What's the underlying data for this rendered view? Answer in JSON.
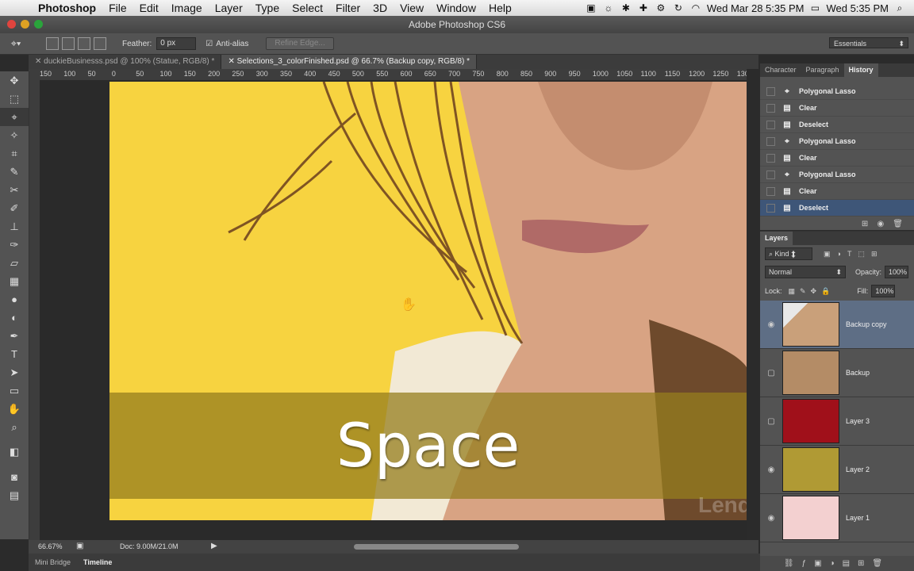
{
  "menubar": {
    "app": "Photoshop",
    "items": [
      "File",
      "Edit",
      "Image",
      "Layer",
      "Type",
      "Select",
      "Filter",
      "3D",
      "View",
      "Window",
      "Help"
    ],
    "date1": "Wed Mar 28  5:35 PM",
    "date2": "Wed 5:35 PM"
  },
  "window": {
    "title": "Adobe Photoshop CS6"
  },
  "options": {
    "feather_label": "Feather:",
    "feather_value": "0 px",
    "antialias_label": "Anti-alias",
    "refine_label": "Refine Edge...",
    "workspace": "Essentials"
  },
  "tabs": [
    {
      "label": "duckieBusinesss.psd @ 100% (Statue, RGB/8) *"
    },
    {
      "label": "Selections_3_colorFinished.psd @ 66.7% (Backup copy, RGB/8) *"
    }
  ],
  "ruler_ticks": [
    "150",
    "100",
    "50",
    "0",
    "50",
    "100",
    "150",
    "200",
    "250",
    "300",
    "350",
    "400",
    "450",
    "500",
    "550",
    "600",
    "650",
    "700",
    "750",
    "800",
    "850",
    "900",
    "950",
    "1000",
    "1050",
    "1100",
    "1150",
    "1200",
    "1250",
    "1300"
  ],
  "canvas": {
    "overlay_text": "Space",
    "watermark": "Lendwings"
  },
  "status": {
    "zoom": "66.67%",
    "doc": "Doc: 9.00M/21.0M"
  },
  "bottom_tabs": [
    "Mini Bridge",
    "Timeline"
  ],
  "history": {
    "tabs": [
      "Character",
      "Paragraph",
      "History"
    ],
    "items": [
      {
        "label": "Polygonal Lasso",
        "icon": "lasso-icon"
      },
      {
        "label": "Clear",
        "icon": "doc-icon"
      },
      {
        "label": "Deselect",
        "icon": "doc-icon"
      },
      {
        "label": "Polygonal Lasso",
        "icon": "lasso-icon"
      },
      {
        "label": "Clear",
        "icon": "doc-icon"
      },
      {
        "label": "Polygonal Lasso",
        "icon": "lasso-icon"
      },
      {
        "label": "Clear",
        "icon": "doc-icon"
      },
      {
        "label": "Deselect",
        "icon": "doc-icon"
      }
    ]
  },
  "layers": {
    "title": "Layers",
    "kind": "Kind",
    "blend": "Normal",
    "opacity_label": "Opacity:",
    "opacity": "100%",
    "lock_label": "Lock:",
    "fill_label": "Fill:",
    "fill": "100%",
    "items": [
      {
        "name": "Backup copy",
        "color": "#c9a07a",
        "visible": true
      },
      {
        "name": "Backup",
        "color": "#b48c66",
        "visible": false
      },
      {
        "name": "Layer 3",
        "color": "#a0101a",
        "visible": false
      },
      {
        "name": "Layer 2",
        "color": "#b09a34",
        "visible": true
      },
      {
        "name": "Layer 1",
        "color": "#f3d0d0",
        "visible": true
      }
    ]
  },
  "colors": {
    "canvas_bg": "#f7d340",
    "banner": "#967d1e",
    "selection": "#3e5678"
  }
}
